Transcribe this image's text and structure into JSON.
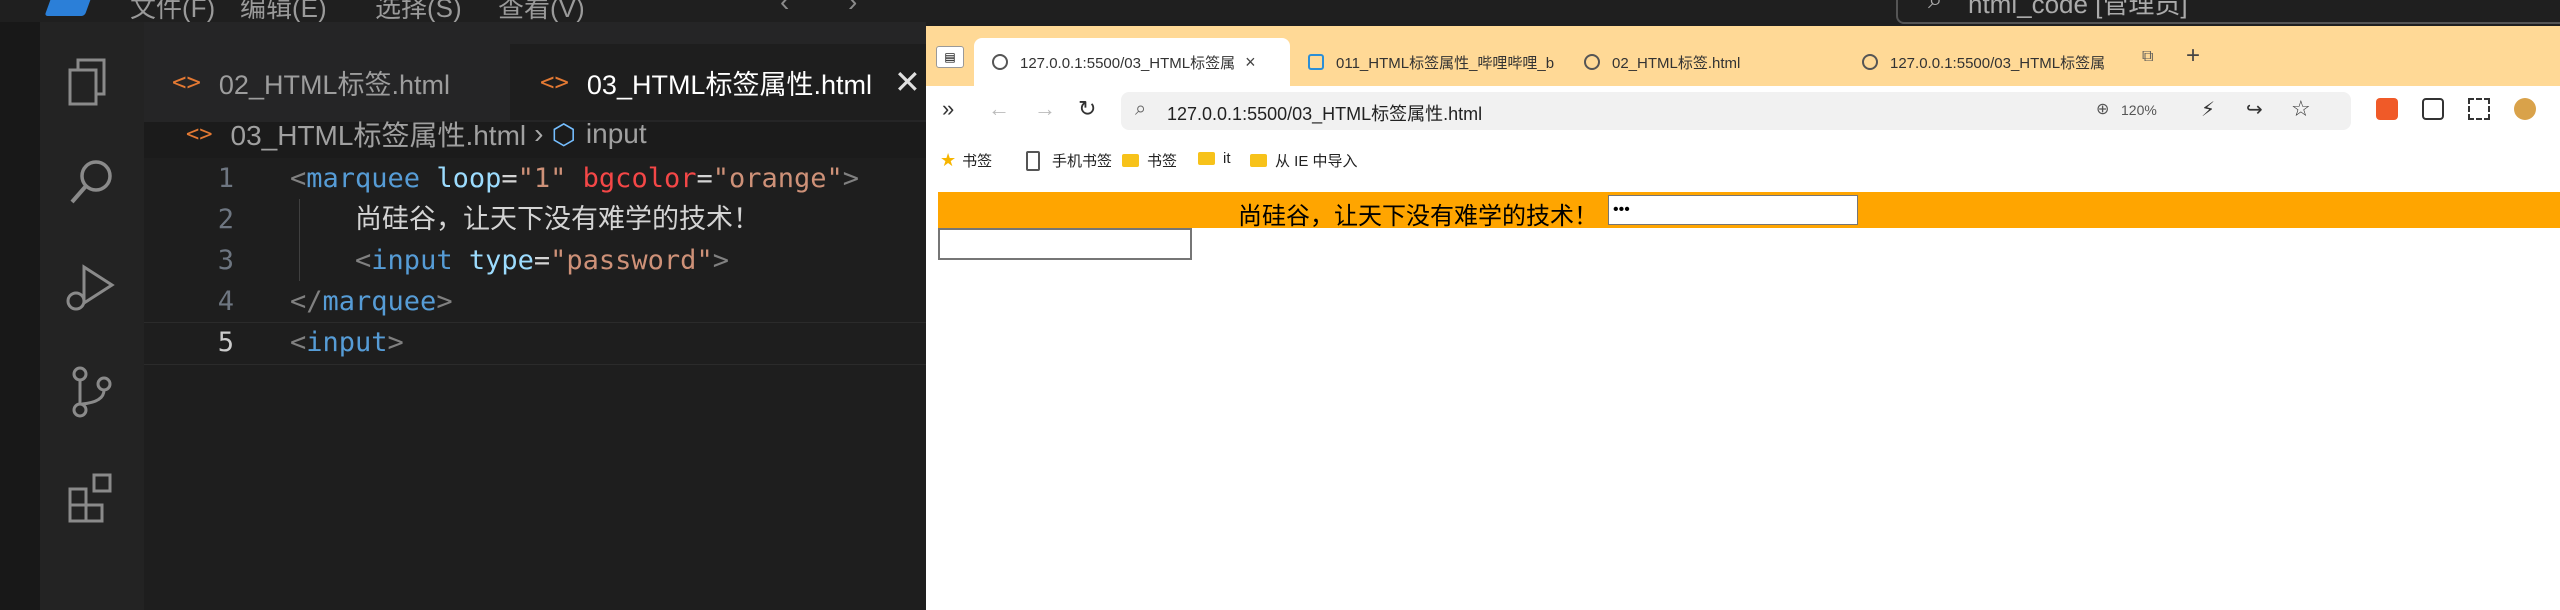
{
  "vscode": {
    "title_menus": [
      "文件(F)",
      "编辑(E)",
      "选择(S)",
      "查看(V)"
    ],
    "tabs": [
      {
        "label": "02_HTML标签.html",
        "icon": "html-file-icon",
        "active": false
      },
      {
        "label": "03_HTML标签属性.html",
        "icon": "html-file-icon",
        "active": true
      }
    ],
    "tab_close_glyph": "✕",
    "breadcrumb": {
      "file": "03_HTML标签属性.html",
      "symbol": "input"
    },
    "code_lines": [
      {
        "num": "1",
        "tokens": [
          [
            "tg",
            "<"
          ],
          [
            "tn",
            "marquee"
          ],
          [
            "tx",
            " "
          ],
          [
            "an",
            "loop"
          ],
          [
            "tx",
            "="
          ],
          [
            "av",
            "\"1\""
          ],
          [
            "tx",
            " "
          ],
          [
            "ar",
            "bgcolor"
          ],
          [
            "tx",
            "="
          ],
          [
            "av",
            "\"orange\""
          ],
          [
            "tg",
            ">"
          ]
        ]
      },
      {
        "num": "2",
        "tokens": [
          [
            "tx",
            "    尚硅谷，让天下没有难学的技术！"
          ]
        ]
      },
      {
        "num": "3",
        "tokens": [
          [
            "tx",
            "    "
          ],
          [
            "tg",
            "<"
          ],
          [
            "tn",
            "input"
          ],
          [
            "tx",
            " "
          ],
          [
            "an",
            "type"
          ],
          [
            "tx",
            "="
          ],
          [
            "av",
            "\"password\""
          ],
          [
            "tg",
            ">"
          ]
        ]
      },
      {
        "num": "4",
        "tokens": [
          [
            "tg",
            "</"
          ],
          [
            "tn",
            "marquee"
          ],
          [
            "tg",
            ">"
          ]
        ]
      },
      {
        "num": "5",
        "tokens": [
          [
            "tg",
            "<"
          ],
          [
            "tn",
            "input"
          ],
          [
            "tg",
            ">"
          ]
        ]
      }
    ],
    "current_line": "5"
  },
  "titlebar_search": "html_code [管理员]",
  "browser": {
    "tabs": [
      {
        "label": "127.0.0.1:5500/03_HTML标签属",
        "active": true
      },
      {
        "label": "011_HTML标签属性_哔哩哔哩_b",
        "active": false
      },
      {
        "label": "02_HTML标签.html",
        "active": false
      },
      {
        "label": "127.0.0.1:5500/03_HTML标签属",
        "active": false
      }
    ],
    "tab_close_glyph": "×",
    "new_tab_glyph": "+",
    "url": "127.0.0.1:5500/03_HTML标签属性.html",
    "zoom": "120%",
    "bookmarks": [
      {
        "label": "书签",
        "icon": "star-icon"
      },
      {
        "label": "手机书签",
        "icon": "phone-icon"
      },
      {
        "label": "书签",
        "icon": "folder-icon"
      },
      {
        "label": "it",
        "icon": "folder-icon"
      },
      {
        "label": "从 IE 中导入",
        "icon": "folder-icon"
      }
    ],
    "page": {
      "marquee_text": "尚硅谷，让天下没有难学的技术！",
      "marquee_bgcolor": "#ffa500",
      "password_value": "123"
    }
  }
}
